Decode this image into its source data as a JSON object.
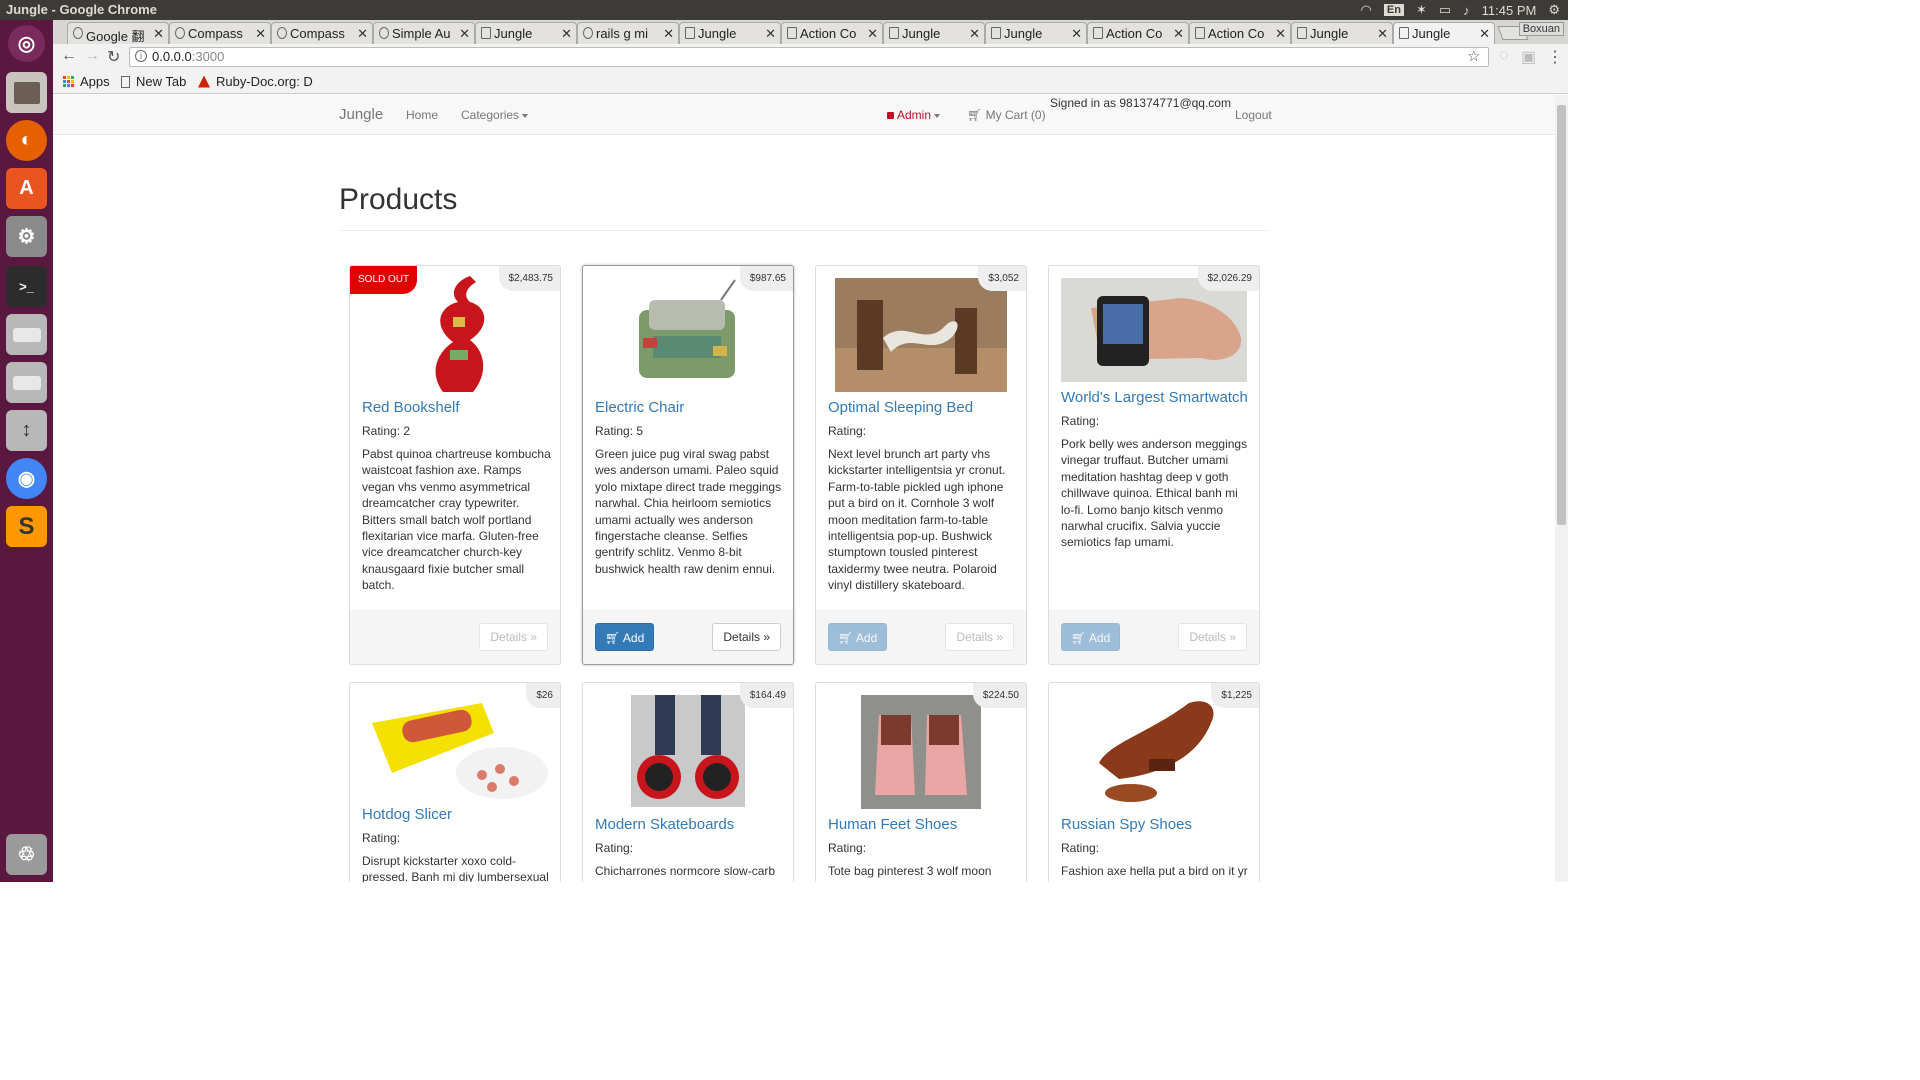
{
  "window_title": "Jungle - Google Chrome",
  "system": {
    "lang": "En",
    "time": "11:45 PM"
  },
  "tabs": [
    {
      "label": "Google 翻"
    },
    {
      "label": "Compass"
    },
    {
      "label": "Compass"
    },
    {
      "label": "Simple Au"
    },
    {
      "label": "Jungle"
    },
    {
      "label": "rails g mi"
    },
    {
      "label": "Jungle"
    },
    {
      "label": "Action Co"
    },
    {
      "label": "Jungle"
    },
    {
      "label": "Jungle"
    },
    {
      "label": "Action Co"
    },
    {
      "label": "Action Co"
    },
    {
      "label": "Jungle"
    },
    {
      "label": "Jungle"
    }
  ],
  "tab_user": "Boxuan",
  "url": {
    "host": "0.0.0.0",
    "port": ":3000"
  },
  "bookmarks": {
    "apps": "Apps",
    "new_tab": "New Tab",
    "ruby": "Ruby-Doc.org: D"
  },
  "navbar": {
    "brand": "Jungle",
    "home": "Home",
    "categories": "Categories",
    "admin": "Admin",
    "cart": "My Cart (0)",
    "signed_in": "Signed in as 981374771@qq.com",
    "logout": "Logout"
  },
  "page_title": "Products",
  "buttons": {
    "add": "Add",
    "details": "Details »",
    "sold_out": "SOLD OUT"
  },
  "products": [
    {
      "name": "Red Bookshelf",
      "price": "$2,483.75",
      "rating": "Rating: 2",
      "sold_out": true,
      "description": "Pabst quinoa chartreuse kombucha waistcoat fashion axe. Ramps vegan vhs venmo asymmetrical dreamcatcher cray typewriter. Bitters small batch wolf portland flexitarian vice marfa. Gluten-free vice dreamcatcher church-key knausgaard fixie butcher small batch."
    },
    {
      "name": "Electric Chair",
      "price": "$987.65",
      "rating": "Rating: 5",
      "sold_out": false,
      "description": "Green juice pug viral swag pabst wes anderson umami. Paleo squid yolo mixtape direct trade meggings narwhal. Chia heirloom semiotics umami actually wes anderson fingerstache cleanse. Selfies gentrify schlitz. Venmo 8-bit bushwick health raw denim ennui."
    },
    {
      "name": "Optimal Sleeping Bed",
      "price": "$3,052",
      "rating": "Rating:",
      "sold_out": false,
      "description": "Next level brunch art party vhs kickstarter intelligentsia yr cronut. Farm-to-table pickled ugh iphone put a bird on it. Cornhole 3 wolf moon meditation farm-to-table intelligentsia pop-up. Bushwick stumptown tousled pinterest taxidermy twee neutra. Polaroid vinyl distillery skateboard."
    },
    {
      "name": "World's Largest Smartwatch",
      "price": "$2,026.29",
      "rating": "Rating:",
      "sold_out": false,
      "description": "Pork belly wes anderson meggings vinegar truffaut. Butcher umami meditation hashtag deep v goth chillwave quinoa. Ethical banh mi lo-fi. Lomo banjo kitsch venmo narwhal crucifix. Salvia yuccie semiotics fap umami."
    },
    {
      "name": "Hotdog Slicer",
      "price": "$26",
      "rating": "Rating:",
      "sold_out": false,
      "description": "Disrupt kickstarter xoxo cold-pressed. Banh mi diy lumbersexual"
    },
    {
      "name": "Modern Skateboards",
      "price": "$164.49",
      "rating": "Rating:",
      "sold_out": false,
      "description": "Chicharrones normcore slow-carb"
    },
    {
      "name": "Human Feet Shoes",
      "price": "$224.50",
      "rating": "Rating:",
      "sold_out": false,
      "description": "Tote bag pinterest 3 wolf moon trust"
    },
    {
      "name": "Russian Spy Shoes",
      "price": "$1,225",
      "rating": "Rating:",
      "sold_out": false,
      "description": "Fashion axe hella put a bird on it yr"
    }
  ]
}
